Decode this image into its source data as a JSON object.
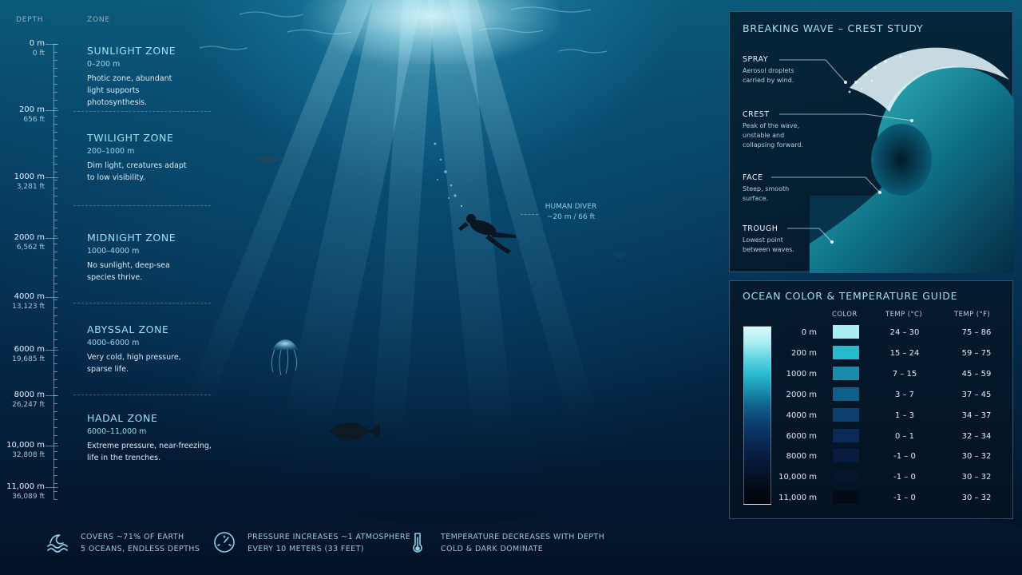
{
  "headers": {
    "depth": "DEPTH",
    "zone": "ZONE"
  },
  "depth_scale": [
    {
      "m": "0 m",
      "ft": "0 ft"
    },
    {
      "m": "200 m",
      "ft": "656 ft"
    },
    {
      "m": "1000 m",
      "ft": "3,281 ft"
    },
    {
      "m": "2000 m",
      "ft": "6,562 ft"
    },
    {
      "m": "4000 m",
      "ft": "13,123 ft"
    },
    {
      "m": "6000 m",
      "ft": "19,685 ft"
    },
    {
      "m": "8000 m",
      "ft": "26,247 ft"
    },
    {
      "m": "10,000 m",
      "ft": "32,808 ft"
    },
    {
      "m": "11,000 m",
      "ft": "36,089 ft"
    }
  ],
  "zones": [
    {
      "title": "SUNLIGHT ZONE",
      "range": "0–200 m",
      "description": "Photic zone, abundant light supports photosynthesis."
    },
    {
      "title": "TWILIGHT ZONE",
      "range": "200–1000 m",
      "description": "Dim light, creatures adapt to low visibility."
    },
    {
      "title": "MIDNIGHT ZONE",
      "range": "1000–4000 m",
      "description": "No sunlight, deep-sea species thrive."
    },
    {
      "title": "ABYSSAL ZONE",
      "range": "4000–6000 m",
      "description": "Very cold, high pressure, sparse life."
    },
    {
      "title": "HADAL ZONE",
      "range": "6000–11,000 m",
      "description": "Extreme pressure, near-freezing, life in the trenches."
    }
  ],
  "diver": {
    "label": "HUMAN DIVER",
    "depth": "~20 m / 66 ft"
  },
  "wave_study": {
    "title": "BREAKING WAVE – CREST STUDY",
    "parts": [
      {
        "title": "SPRAY",
        "description": "Aerosol droplets carried by wind."
      },
      {
        "title": "CREST",
        "description": "Peak of the wave, unstable and collapsing forward."
      },
      {
        "title": "FACE",
        "description": "Steep, smooth surface."
      },
      {
        "title": "TROUGH",
        "description": "Lowest point between waves."
      }
    ]
  },
  "color_guide": {
    "title": "OCEAN COLOR & TEMPERATURE GUIDE",
    "headers": {
      "color": "COLOR",
      "temp_c": "TEMP (°C)",
      "temp_f": "TEMP (°F)"
    },
    "rows": [
      {
        "depth": "0 m",
        "color": "#a8eef2",
        "temp_c": "24 – 30",
        "temp_f": "75 – 86"
      },
      {
        "depth": "200 m",
        "color": "#27b9cc",
        "temp_c": "15 – 24",
        "temp_f": "59 – 75"
      },
      {
        "depth": "1000 m",
        "color": "#1a8bad",
        "temp_c": "7 – 15",
        "temp_f": "45 – 59"
      },
      {
        "depth": "2000 m",
        "color": "#0f5f88",
        "temp_c": "3 – 7",
        "temp_f": "37 – 45"
      },
      {
        "depth": "4000 m",
        "color": "#0b3f6e",
        "temp_c": "1 – 3",
        "temp_f": "34 – 37"
      },
      {
        "depth": "6000 m",
        "color": "#0a2b57",
        "temp_c": "0 – 1",
        "temp_f": "32 – 34"
      },
      {
        "depth": "8000 m",
        "color": "#081c40",
        "temp_c": "-1 – 0",
        "temp_f": "30 – 32"
      },
      {
        "depth": "10,000 m",
        "color": "#06142e",
        "temp_c": "-1 – 0",
        "temp_f": "30 – 32"
      },
      {
        "depth": "11,000 m",
        "color": "#040a18",
        "temp_c": "-1 – 0",
        "temp_f": "30 – 32"
      }
    ],
    "gradient": [
      "#d8fbff",
      "#a8eef2",
      "#5fd3e3",
      "#27b9cc",
      "#1a8bad",
      "#0f5f88",
      "#0b3f6e",
      "#0a2b57",
      "#081c40",
      "#06142e",
      "#040a18",
      "#010308"
    ]
  },
  "stats": [
    {
      "icon": "wave-icon",
      "line1": "COVERS ~71% OF EARTH",
      "line2": "5 OCEANS, ENDLESS DEPTHS"
    },
    {
      "icon": "pressure-gauge-icon",
      "line1": "PRESSURE INCREASES ~1 ATMOSPHERE",
      "line2": "EVERY 10 METERS (33 FEET)"
    },
    {
      "icon": "thermometer-icon",
      "line1": "TEMPERATURE DECREASES WITH DEPTH",
      "line2": "COLD & DARK DOMINATE"
    }
  ]
}
